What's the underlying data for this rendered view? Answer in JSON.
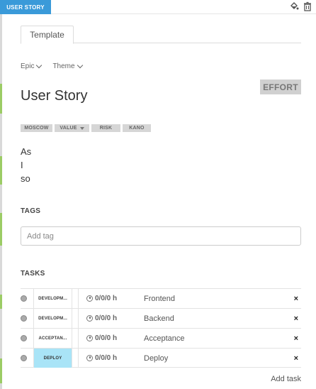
{
  "header": {
    "tab_label": "USER STORY",
    "icons": [
      "paint-bucket-icon",
      "trash-icon"
    ]
  },
  "tabs": [
    {
      "label": "Template"
    }
  ],
  "dropdowns": {
    "epic": "Epic",
    "theme": "Theme"
  },
  "effort_label": "EFFORT",
  "title": "User Story",
  "badges": [
    "MOSCOW",
    "VALUE",
    "RISK",
    "KANO"
  ],
  "story": {
    "line1": "As",
    "line2": "I",
    "line3": "so"
  },
  "tags": {
    "label": "TAGS",
    "placeholder": "Add tag"
  },
  "tasks": {
    "label": "TASKS",
    "items": [
      {
        "type": "DEVELOPM...",
        "hours": "0/0/0 h",
        "name": "Frontend",
        "delete": "×"
      },
      {
        "type": "DEVELOPM...",
        "hours": "0/0/0 h",
        "name": "Backend",
        "delete": "×"
      },
      {
        "type": "ACCEPTAN...",
        "hours": "0/0/0 h",
        "name": "Acceptance",
        "delete": "×"
      },
      {
        "type": "DEPLOY",
        "hours": "0/0/0 h",
        "name": "Deploy",
        "delete": "×"
      }
    ],
    "add_label": "Add task"
  },
  "colors": {
    "accent": "#3a9ad9",
    "deploy_type": "#a9e4f7",
    "strip_green": "#9ccc65"
  }
}
